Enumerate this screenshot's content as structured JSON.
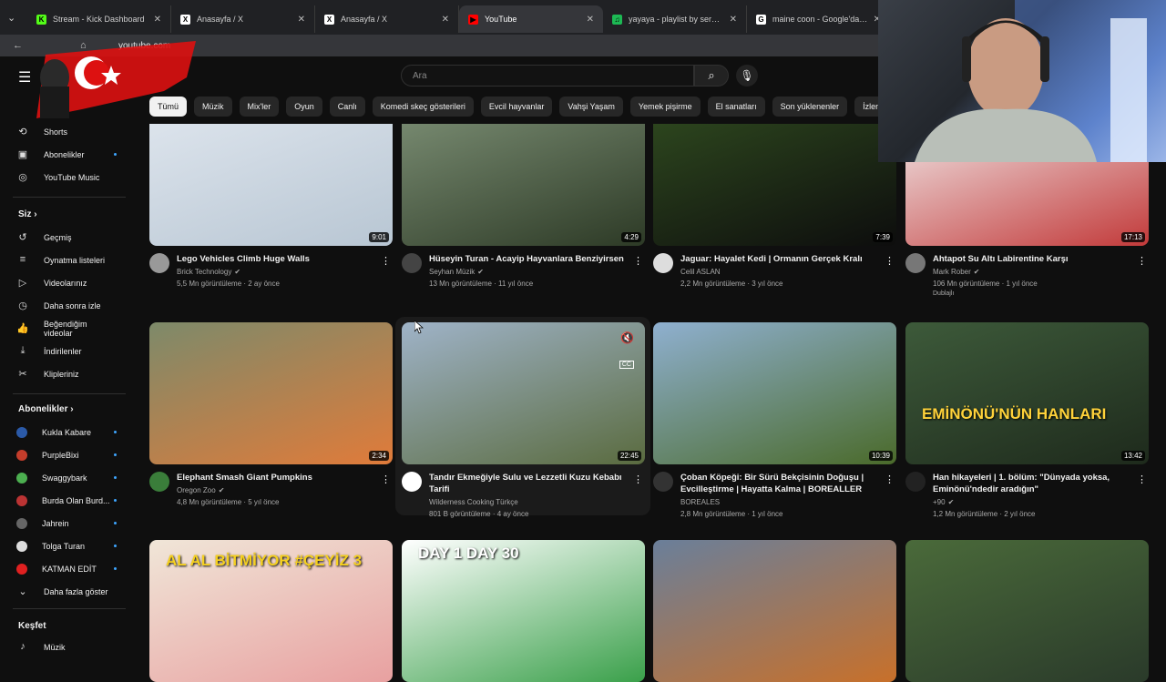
{
  "browser": {
    "tabs": [
      {
        "title": "Stream - Kick Dashboard",
        "icon": "kick-icon",
        "color": "#53fc18",
        "glyph": "K"
      },
      {
        "title": "Anasayfa / X",
        "icon": "x-icon",
        "color": "#ffffff",
        "glyph": "X"
      },
      {
        "title": "Anasayfa / X",
        "icon": "x-icon",
        "color": "#ffffff",
        "glyph": "X"
      },
      {
        "title": "YouTube",
        "icon": "youtube-icon",
        "color": "#ff0000",
        "glyph": "▶",
        "active": true
      },
      {
        "title": "yayaya - playlist by serhat | Spo",
        "icon": "spotify-icon",
        "color": "#1db954",
        "glyph": "♫"
      },
      {
        "title": "maine coon - Google'da Ara",
        "icon": "google-icon",
        "color": "#ffffff",
        "glyph": "G"
      }
    ],
    "url": "youtube.com"
  },
  "header": {
    "search_placeholder": "Ara"
  },
  "chips": [
    "Tümü",
    "Müzik",
    "Mix'ler",
    "Oyun",
    "Canlı",
    "Komedi skeç gösterileri",
    "Evcil hayvanlar",
    "Vahşi Yaşam",
    "Yemek pişirme",
    "El sanatları",
    "Son yüklenenler",
    "İzlenenler",
    "Yeni önerile"
  ],
  "sidebar": {
    "top_items": [
      {
        "label": "Shorts",
        "icon": "shorts-icon",
        "glyph": "⟲"
      },
      {
        "label": "Abonelikler",
        "icon": "subscriptions-icon",
        "glyph": "▣",
        "dot": true
      },
      {
        "label": "YouTube Music",
        "icon": "youtube-music-icon",
        "glyph": "◎"
      }
    ],
    "you_title": "Siz",
    "you_items": [
      {
        "label": "Geçmiş",
        "icon": "history-icon",
        "glyph": "↺"
      },
      {
        "label": "Oynatma listeleri",
        "icon": "playlists-icon",
        "glyph": "≡"
      },
      {
        "label": "Videolarınız",
        "icon": "your-videos-icon",
        "glyph": "▷"
      },
      {
        "label": "Daha sonra izle",
        "icon": "watch-later-icon",
        "glyph": "◷"
      },
      {
        "label": "Beğendiğim videolar",
        "icon": "liked-icon",
        "glyph": "👍"
      },
      {
        "label": "İndirilenler",
        "icon": "downloads-icon",
        "glyph": "⤓"
      },
      {
        "label": "Klipleriniz",
        "icon": "clips-icon",
        "glyph": "✂"
      }
    ],
    "subs_title": "Abonelikler",
    "subs": [
      {
        "label": "Kukla Kabare",
        "color": "#2b5aa8",
        "dot": true
      },
      {
        "label": "PurpleBixi",
        "color": "#c43d2b",
        "dot": true
      },
      {
        "label": "Swaggybark",
        "color": "#4caf50",
        "dot": true
      },
      {
        "label": "Burda Olan Burd...",
        "color": "#b33",
        "dot": true
      },
      {
        "label": "Jahrein",
        "color": "#666",
        "dot": true
      },
      {
        "label": "Tolga Turan",
        "color": "#ddd",
        "dot": true
      },
      {
        "label": "KATMAN EDİT",
        "color": "#e02020",
        "dot": true
      }
    ],
    "more_label": "Daha fazla göster",
    "explore_title": "Keşfet",
    "explore_items": [
      {
        "label": "Müzik",
        "icon": "music-icon",
        "glyph": "♪"
      }
    ]
  },
  "videos": [
    {
      "title": "Lego Vehicles Climb Huge Walls",
      "channel": "Brick Technology",
      "verified": true,
      "stats": "5,5 Mn görüntüleme · 2 ay önce",
      "duration": "9:01",
      "thumb": [
        "#dfe6ee",
        "#b8c6d3"
      ],
      "av": "#999"
    },
    {
      "title": "Hüseyin  Turan - Acayip Hayvanlara Benziyirsen",
      "channel": "Seyhan Müzik",
      "verified": true,
      "stats": "13 Mn görüntüleme · 11 yıl önce",
      "duration": "4:29",
      "thumb": [
        "#7c8f75",
        "#2d3a26"
      ],
      "av": "#444"
    },
    {
      "title": "Jaguar: Hayalet Kedi | Ormanın Gerçek Kralı",
      "channel": "Celil ASLAN",
      "verified": false,
      "stats": "2,2 Mn görüntüleme · 3 yıl önce",
      "duration": "7:39",
      "thumb": [
        "#2f4a1f",
        "#0d0d0d"
      ],
      "av": "#ddd"
    },
    {
      "title": "Ahtapot Su Altı Labirentine Karşı",
      "channel": "Mark Rober",
      "verified": true,
      "stats": "106 Mn görüntüleme · 1 yıl önce",
      "duration": "17:13",
      "thumb": [
        "#f4f4f4",
        "#c23a3a"
      ],
      "av": "#777",
      "badge": "Dublajlı"
    },
    {
      "title": "Elephant Smash Giant Pumpkins",
      "channel": "Oregon Zoo",
      "verified": true,
      "stats": "4,8 Mn görüntüleme · 5 yıl önce",
      "duration": "2:34",
      "thumb": [
        "#7d8a6a",
        "#e07b3a"
      ],
      "av": "#3a7d3a"
    },
    {
      "title": "Tandır Ekmeğiyle Sulu ve Lezzetli Kuzu Kebabı Tarifi",
      "channel": "Wilderness Cooking Türkçe",
      "verified": false,
      "stats": "801 B görüntüleme · 4 ay önce",
      "duration": "22:45",
      "thumb": [
        "#9fb3c8",
        "#5a6b3f"
      ],
      "av": "#fff"
    },
    {
      "title": "Çoban Köpeği: Bir Sürü Bekçisinin Doğuşu | Evcilleştirme | Hayatta Kalma | BOREALLER",
      "channel": "BOREALES",
      "verified": false,
      "stats": "2,8 Mn görüntüleme · 1 yıl önce",
      "duration": "10:39",
      "thumb": [
        "#8fb0d0",
        "#4a6a2a"
      ],
      "av": "#333"
    },
    {
      "title": "Han hikayeleri | 1. bölüm: \"Dünyada yoksa, Eminönü'ndedir aradığın\"",
      "channel": "+90",
      "verified": true,
      "stats": "1,2 Mn görüntüleme · 2 yıl önce",
      "duration": "13:42",
      "thumb": [
        "#3d5a3a",
        "#1e2a1c"
      ],
      "av": "#222",
      "overlay": "EMİNÖNÜ'NÜN HANLARI"
    },
    {
      "title": "",
      "channel": "",
      "stats": "",
      "duration": "",
      "thumb": [
        "#f0e6d8",
        "#e8a0a0"
      ],
      "overlay": "AL AL BİTMİYOR #ÇEYİZ 3"
    },
    {
      "title": "",
      "channel": "",
      "stats": "",
      "duration": "",
      "thumb": [
        "#ffffff",
        "#3aa04a"
      ],
      "overlay": "DAY 1     DAY 30"
    },
    {
      "title": "",
      "channel": "",
      "stats": "",
      "duration": "",
      "thumb": [
        "#6a7f9a",
        "#c8702a"
      ]
    },
    {
      "title": "",
      "channel": "",
      "stats": "",
      "duration": "",
      "thumb": [
        "#4a6a3a",
        "#2a3a2a"
      ]
    }
  ]
}
